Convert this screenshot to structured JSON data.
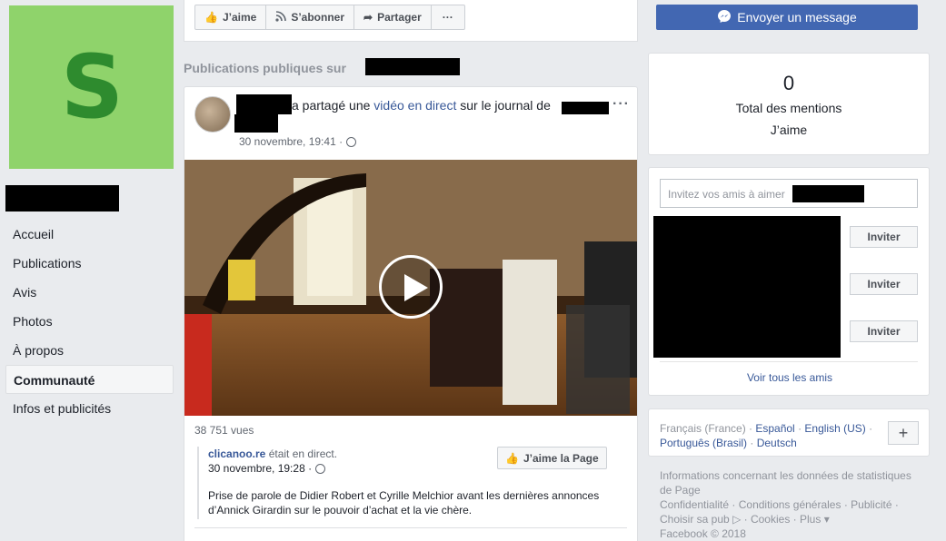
{
  "page": {
    "avatar_letter": "S"
  },
  "nav": {
    "items": [
      {
        "label": "Accueil"
      },
      {
        "label": "Publications"
      },
      {
        "label": "Avis"
      },
      {
        "label": "Photos"
      },
      {
        "label": "À propos"
      },
      {
        "label": "Communauté",
        "active": true
      },
      {
        "label": "Infos et publicités"
      }
    ]
  },
  "actions": {
    "like": "J’aime",
    "follow": "S’abonner",
    "share": "Partager",
    "more": "···"
  },
  "section_title": "Publications publiques sur",
  "post": {
    "action_text": "a partagé une",
    "link_text": "vidéo en direct",
    "journal_text": "sur le journal de",
    "time": "30 novembre, 19:41 ·",
    "more": "···",
    "views": "38 751 vues",
    "shared_source": "clicanoo.re",
    "shared_status": "était en direct.",
    "shared_time": "30 novembre, 19:28 ·",
    "like_page_label": "J’aime la Page",
    "description": "Prise de parole de Didier Robert et Cyrille Melchior avant les dernières annonces d’Annick Girardin sur le pouvoir d’achat et la vie chère."
  },
  "messenger": {
    "label": "Envoyer un message"
  },
  "likes_card": {
    "count": "0",
    "line1": "Total des mentions",
    "line2": "J’aime"
  },
  "invite_card": {
    "placeholder": "Invitez vos amis à aimer",
    "invite_label": "Inviter",
    "see_all": "Voir tous les amis"
  },
  "languages": {
    "current": "Français (France)",
    "others": [
      "Español",
      "English (US)",
      "Português (Brasil)",
      "Deutsch"
    ],
    "plus": "+"
  },
  "footer": {
    "line1": "Informations concernant les données de statistiques de Page",
    "links": [
      "Confidentialité",
      "Conditions générales",
      "Publicité",
      "Choisir sa pub",
      "Cookies",
      "Plus"
    ],
    "copyright": "Facebook © 2018"
  },
  "colors": {
    "brand": "#4267b2",
    "link": "#385898",
    "avatar_bg": "#8fd36b",
    "avatar_letter": "#2e8b2e"
  }
}
